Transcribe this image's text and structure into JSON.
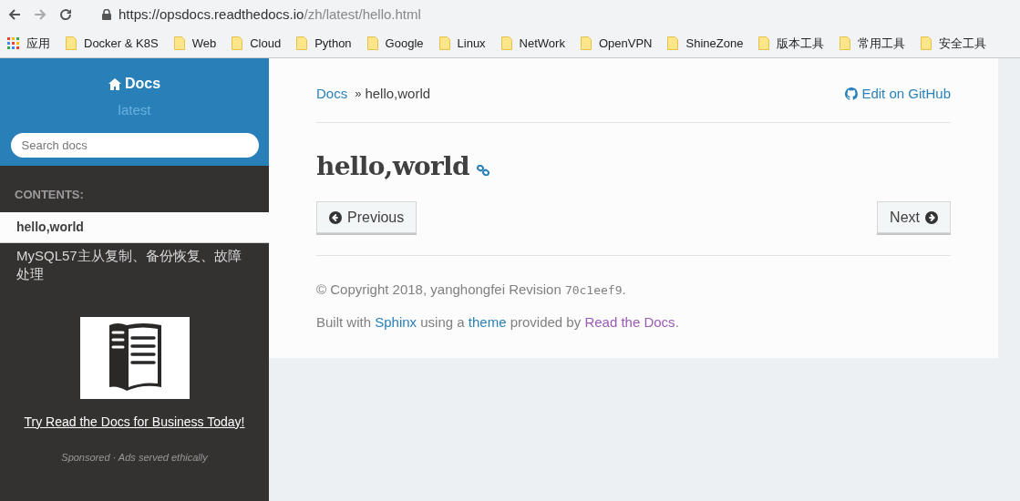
{
  "browser": {
    "url_host": "https://opsdocs.readthedocs.io",
    "url_path": "/zh/latest/hello.html",
    "bookmarks": [
      {
        "kind": "apps",
        "label": "应用"
      },
      {
        "kind": "folder",
        "label": "Docker & K8S"
      },
      {
        "kind": "folder",
        "label": "Web"
      },
      {
        "kind": "folder",
        "label": "Cloud"
      },
      {
        "kind": "folder",
        "label": "Python"
      },
      {
        "kind": "folder",
        "label": "Google"
      },
      {
        "kind": "folder",
        "label": "Linux"
      },
      {
        "kind": "folder",
        "label": "NetWork"
      },
      {
        "kind": "folder",
        "label": "OpenVPN"
      },
      {
        "kind": "folder",
        "label": "ShineZone"
      },
      {
        "kind": "folder",
        "label": "版本工具"
      },
      {
        "kind": "folder",
        "label": "常用工具"
      },
      {
        "kind": "folder",
        "label": "安全工具"
      }
    ]
  },
  "sidebar": {
    "title": "Docs",
    "version": "latest",
    "search": {
      "placeholder": "Search docs"
    },
    "caption": "CONTENTS:",
    "items": [
      {
        "label": "hello,world",
        "selected": true
      },
      {
        "label": "MySQL57主从复制、备份恢复、故障处理",
        "selected": false
      }
    ],
    "ad": {
      "link": "Try Read the Docs for Business Today!",
      "note": "Sponsored · Ads served ethically"
    }
  },
  "breadcrumb": {
    "root": "Docs",
    "separator": "»",
    "current": "hello,world",
    "edit": "Edit on GitHub"
  },
  "heading": "hello,world",
  "buttons": [
    {
      "kind": "previous",
      "label": "Previous"
    },
    {
      "kind": "next",
      "label": "Next"
    }
  ],
  "footer": {
    "copyright": "© Copyright 2018, yanghongfei Revision ",
    "revision": "70c1eef9",
    "copyright_end": ".",
    "built": [
      {
        "kind": "text",
        "text": "Built with "
      },
      {
        "kind": "link",
        "text": "Sphinx",
        "color": "#2980b9"
      },
      {
        "kind": "text",
        "text": " using a "
      },
      {
        "kind": "link",
        "text": "theme",
        "color": "#2980b9"
      },
      {
        "kind": "text",
        "text": " provided by "
      },
      {
        "kind": "link",
        "text": "Read the Docs",
        "color": "#9b59b6"
      },
      {
        "kind": "text",
        "text": "."
      }
    ]
  }
}
